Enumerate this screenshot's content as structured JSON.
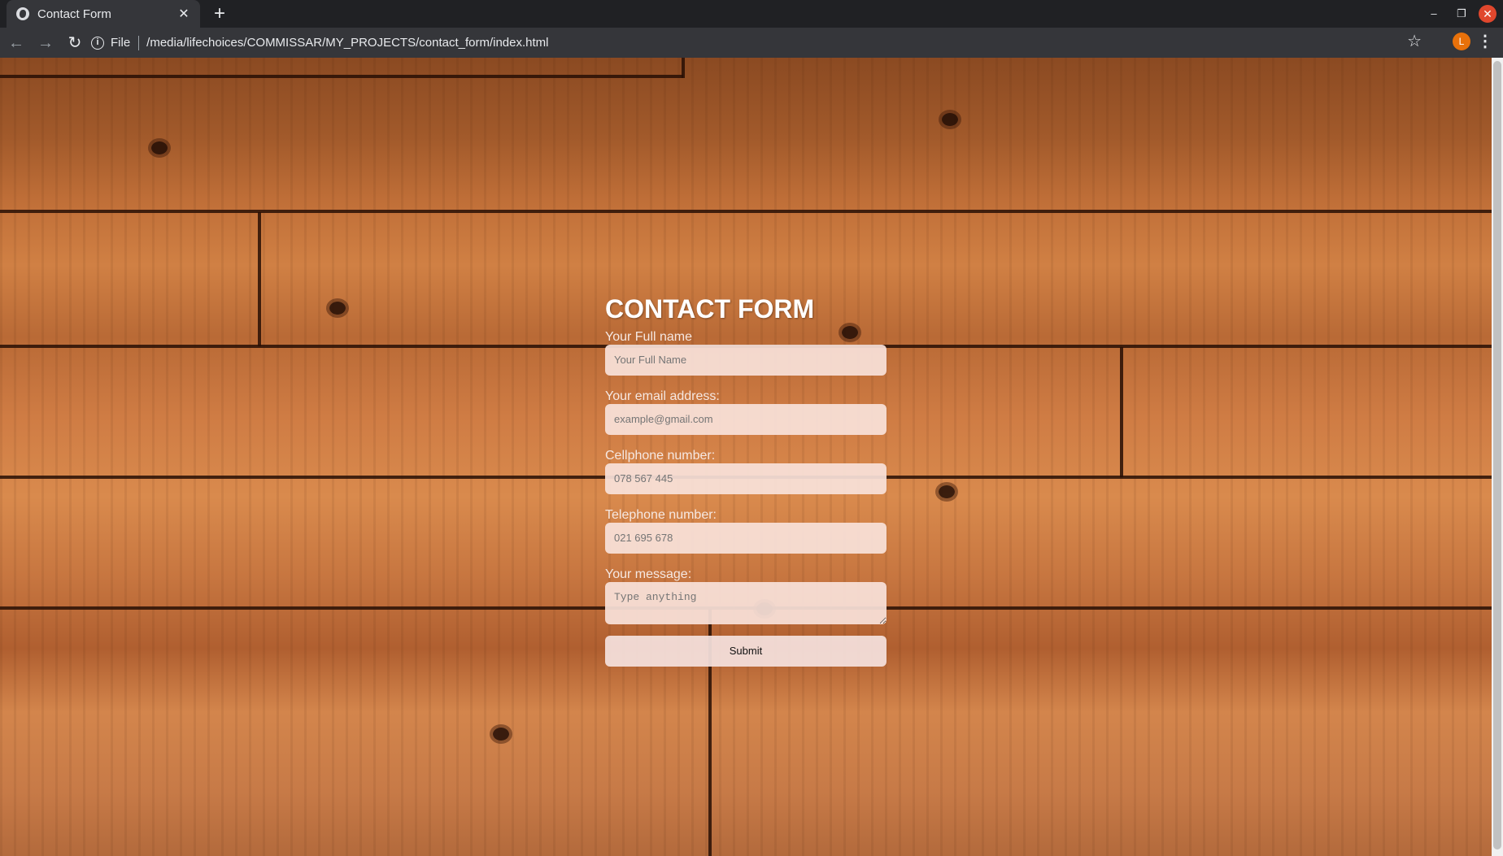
{
  "browser": {
    "tab_title": "Contact Form",
    "tab_close": "✕",
    "new_tab": "+",
    "url_scheme": "File",
    "url_path": "/media/lifechoices/COMMISSAR/MY_PROJECTS/contact_form/index.html",
    "profile_initial": "L",
    "icons": [
      "globe-icon",
      "back-icon",
      "forward-icon",
      "reload-icon",
      "info-icon",
      "star-icon",
      "menu-icon"
    ]
  },
  "form": {
    "heading": "CONTACT FORM",
    "fields": [
      {
        "label": "Your Full name",
        "placeholder": "Your Full Name"
      },
      {
        "label": "Your email address:",
        "placeholder": "example@gmail.com"
      },
      {
        "label": "Cellphone number:",
        "placeholder": "078 567 445"
      },
      {
        "label": "Telephone number:",
        "placeholder": "021 695 678"
      },
      {
        "label": "Your message:",
        "placeholder": "Type anything"
      }
    ],
    "submit_label": "Submit"
  },
  "colors": {
    "chrome_dark": "#202124",
    "toolbar": "#35363a",
    "profile": "#e8710a",
    "close": "#e0472d",
    "wood": "#c77640"
  }
}
